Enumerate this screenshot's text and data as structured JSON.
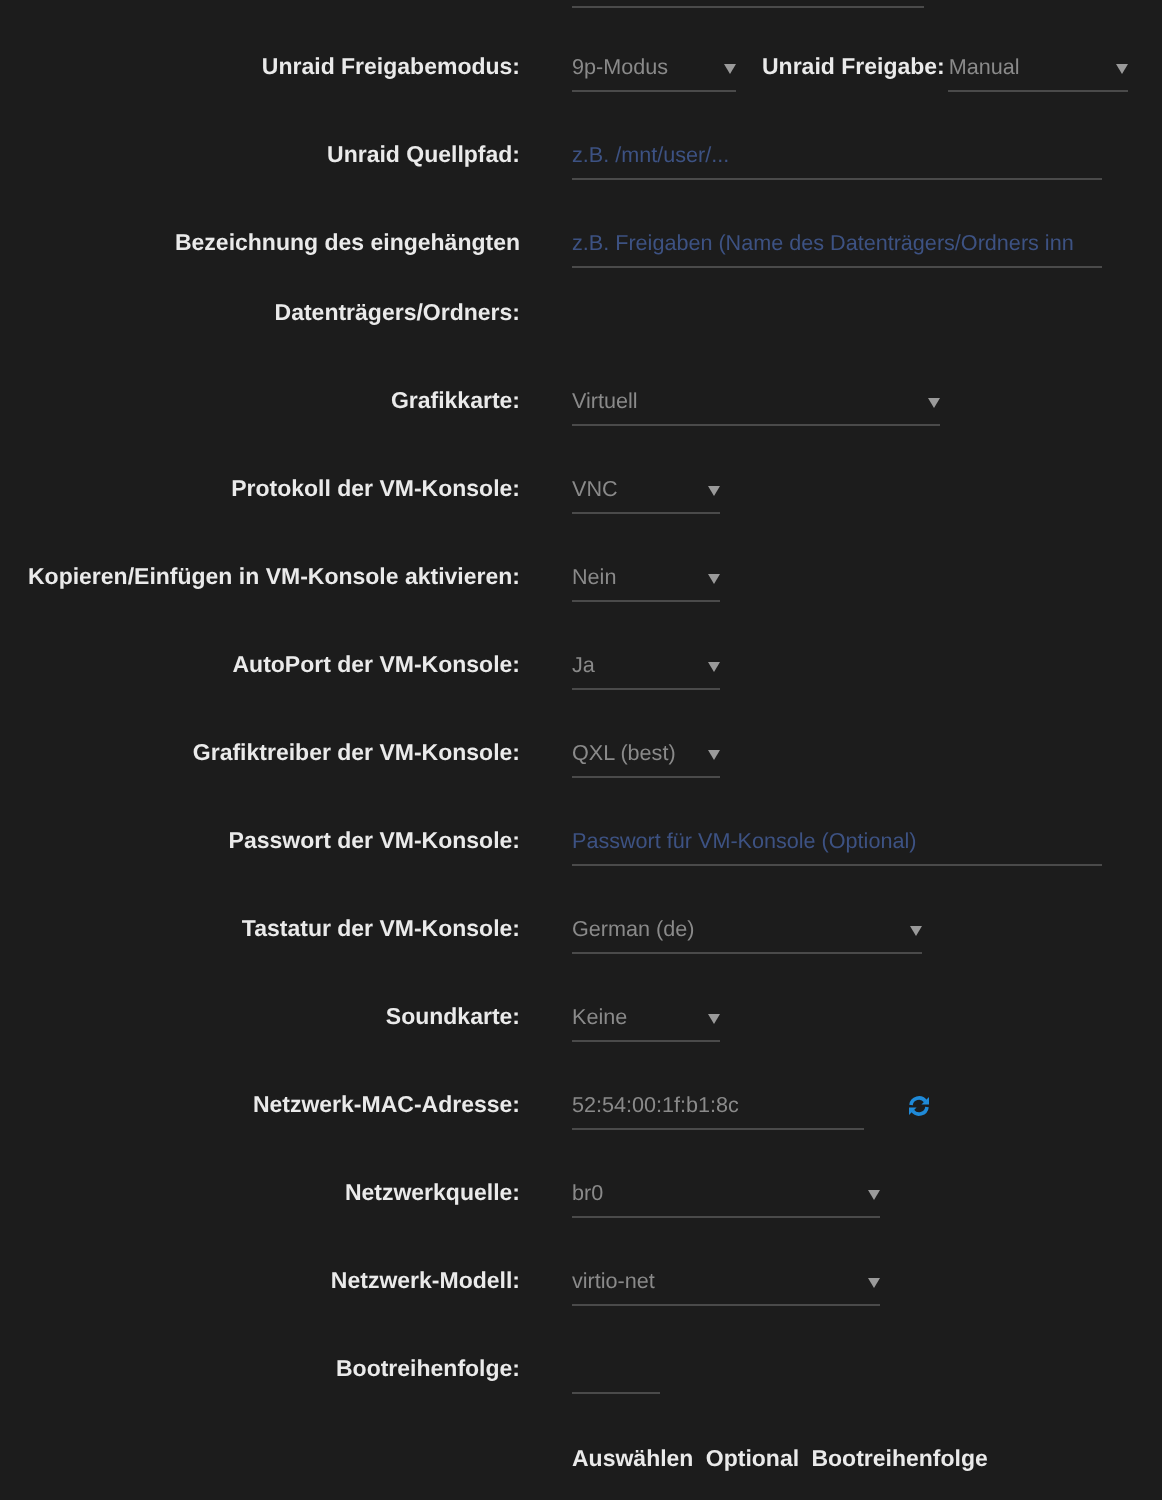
{
  "rows": [
    {
      "label": "Unraid Freigabemodus:",
      "kind": "select",
      "value": "9p-Modus",
      "extra": {
        "label": "Unraid Freigabe:",
        "kind": "select",
        "value": "Manual"
      }
    },
    {
      "label": "Unraid Quellpfad:",
      "kind": "input",
      "placeholder": "z.B. /mnt/user/..."
    },
    {
      "label": "Bezeichnung des eingehängten Datenträgers/Ordners:",
      "kind": "input",
      "placeholder": "z.B. Freigaben (Name des Datenträgers/Ordners inn"
    },
    {
      "label": "Grafikkarte:",
      "kind": "select",
      "value": "Virtuell"
    },
    {
      "label": "Protokoll der VM-Konsole:",
      "kind": "select",
      "value": "VNC"
    },
    {
      "label": "Kopieren/Einfügen in VM-Konsole aktivieren:",
      "kind": "select",
      "value": "Nein"
    },
    {
      "label": "AutoPort der VM-Konsole:",
      "kind": "select",
      "value": "Ja"
    },
    {
      "label": "Grafiktreiber der VM-Konsole:",
      "kind": "select",
      "value": "QXL (best)"
    },
    {
      "label": "Passwort der VM-Konsole:",
      "kind": "input",
      "placeholder": "Passwort für VM-Konsole (Optional)"
    },
    {
      "label": "Tastatur der VM-Konsole:",
      "kind": "select",
      "value": "German (de)"
    },
    {
      "label": "Soundkarte:",
      "kind": "select",
      "value": "Keine"
    },
    {
      "label": "Netzwerk-MAC-Adresse:",
      "kind": "mac",
      "value": "52:54:00:1f:b1:8c"
    },
    {
      "label": "Netzwerkquelle:",
      "kind": "select",
      "value": "br0"
    },
    {
      "label": "Netzwerk-Modell:",
      "kind": "select",
      "value": "virtio-net"
    },
    {
      "label": "Bootreihenfolge:",
      "kind": "input"
    }
  ],
  "hint": "Auswählen Optional Bootreihenfolge"
}
